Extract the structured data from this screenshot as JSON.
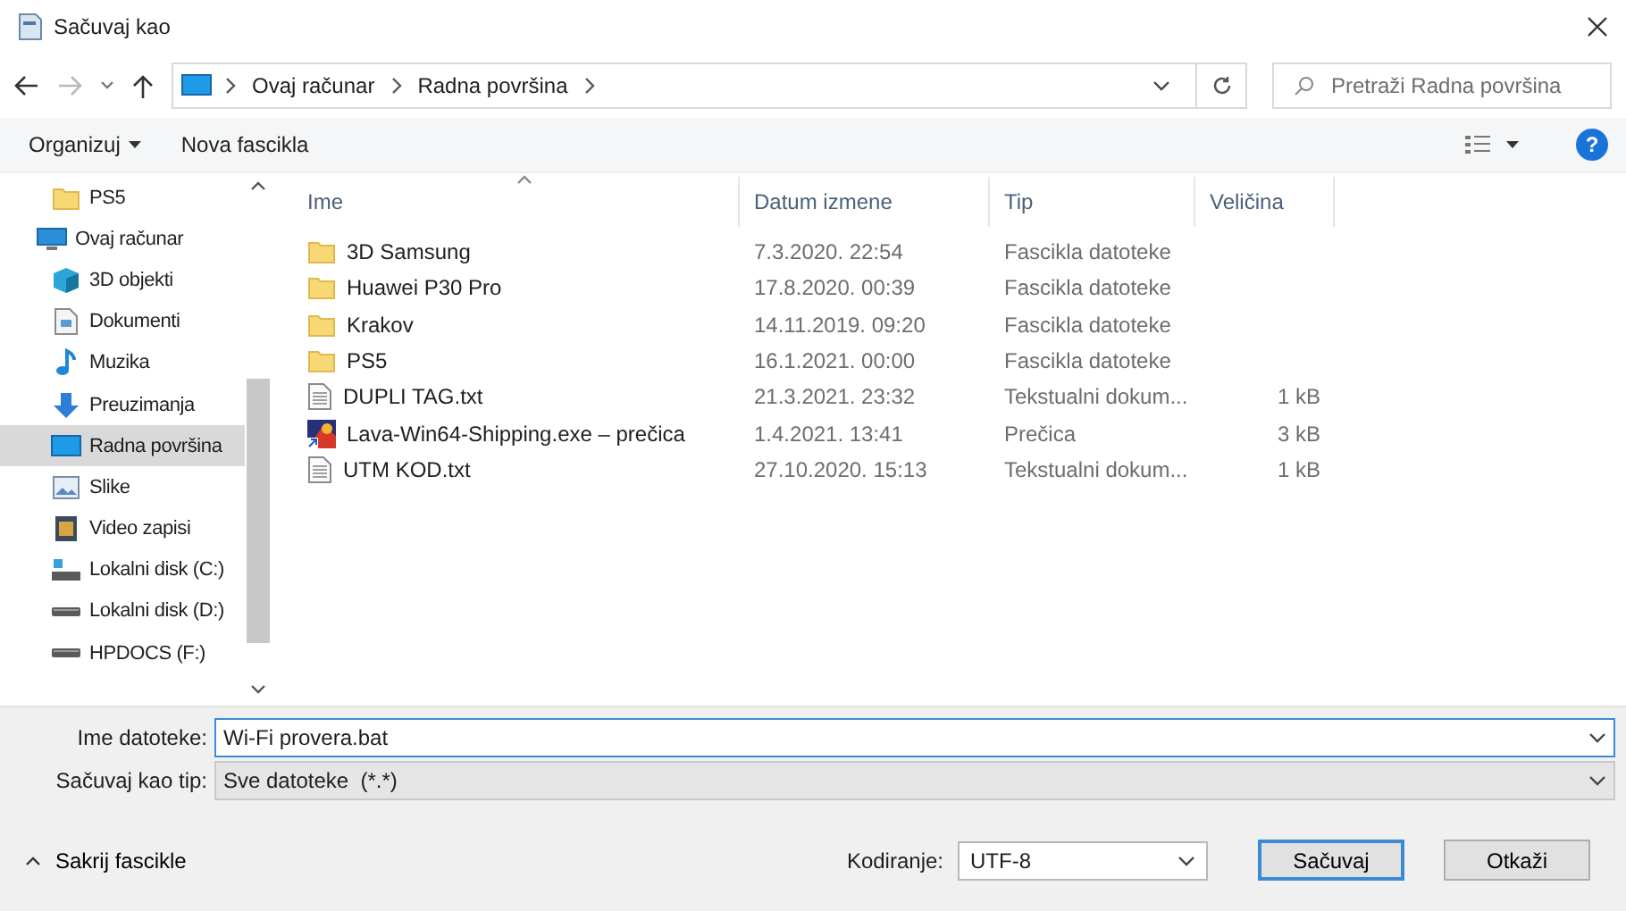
{
  "window": {
    "title": "Sačuvaj kao"
  },
  "address": {
    "path": [
      "Ovaj računar",
      "Radna površina"
    ],
    "search": {
      "placeholder": "Pretraži Radna površina"
    }
  },
  "toolbar": {
    "organize": "Organizuj",
    "new_folder": "Nova fascikla",
    "help": "?"
  },
  "sidebar": {
    "items": [
      {
        "label": "PS5",
        "kind": "folder",
        "selected": false
      },
      {
        "label": "Ovaj računar",
        "kind": "pc",
        "selected": false,
        "children": [
          {
            "label": "3D objekti",
            "kind": "cube",
            "selected": false
          },
          {
            "label": "Dokumenti",
            "kind": "doc",
            "selected": false
          },
          {
            "label": "Muzika",
            "kind": "music",
            "selected": false
          },
          {
            "label": "Preuzimanja",
            "kind": "download",
            "selected": false
          },
          {
            "label": "Radna površina",
            "kind": "desktop",
            "selected": true
          },
          {
            "label": "Slike",
            "kind": "pictures",
            "selected": false
          },
          {
            "label": "Video zapisi",
            "kind": "video",
            "selected": false
          },
          {
            "label": "Lokalni disk (C:)",
            "kind": "sysdisk",
            "selected": false
          },
          {
            "label": "Lokalni disk (D:)",
            "kind": "disk",
            "selected": false
          },
          {
            "label": "HPDOCS (F:)",
            "kind": "disk",
            "selected": false
          }
        ]
      }
    ]
  },
  "table": {
    "columns": [
      {
        "label": "Ime",
        "sorted": true
      },
      {
        "label": "Datum izmene",
        "sorted": false
      },
      {
        "label": "Tip",
        "sorted": false
      },
      {
        "label": "Veličina",
        "sorted": false
      }
    ],
    "rows": [
      {
        "kind": "folder",
        "name": "3D Samsung",
        "date": "7.3.2020. 22:54",
        "type": "Fascikla datoteke"
      },
      {
        "kind": "folder",
        "name": "Huawei P30 Pro",
        "date": "17.8.2020. 00:39",
        "type": "Fascikla datoteke"
      },
      {
        "kind": "folder",
        "name": "Krakov",
        "date": "14.11.2019. 09:20",
        "type": "Fascikla datoteke"
      },
      {
        "kind": "folder",
        "name": "PS5",
        "date": "16.1.2021. 00:00",
        "type": "Fascikla datoteke"
      },
      {
        "kind": "txt",
        "name": "DUPLI TAG.txt",
        "date": "21.3.2021. 23:32",
        "type": "Tekstualni dokum...",
        "size": "1 kB"
      },
      {
        "kind": "shortcut",
        "name": "Lava-Win64-Shipping.exe – prečica",
        "date": "1.4.2021. 13:41",
        "type": "Prečica",
        "size": "3 kB"
      },
      {
        "kind": "txt",
        "name": "UTM KOD.txt",
        "date": "27.10.2020. 15:13",
        "type": "Tekstualni dokum...",
        "size": "1 kB"
      }
    ]
  },
  "form": {
    "file_name": {
      "label": "Ime datoteke:",
      "value": "Wi-Fi provera.bat"
    },
    "file_type": {
      "label": "Sačuvaj kao tip:",
      "value": "Sve datoteke  (*.*)"
    }
  },
  "footer": {
    "hide_folders": "Sakrij fascikle",
    "encoding": {
      "label": "Kodiranje:",
      "value": "UTF-8"
    },
    "buttons": [
      {
        "label": "Sačuvaj",
        "default": true
      },
      {
        "label": "Otkaži",
        "default": false
      }
    ]
  }
}
